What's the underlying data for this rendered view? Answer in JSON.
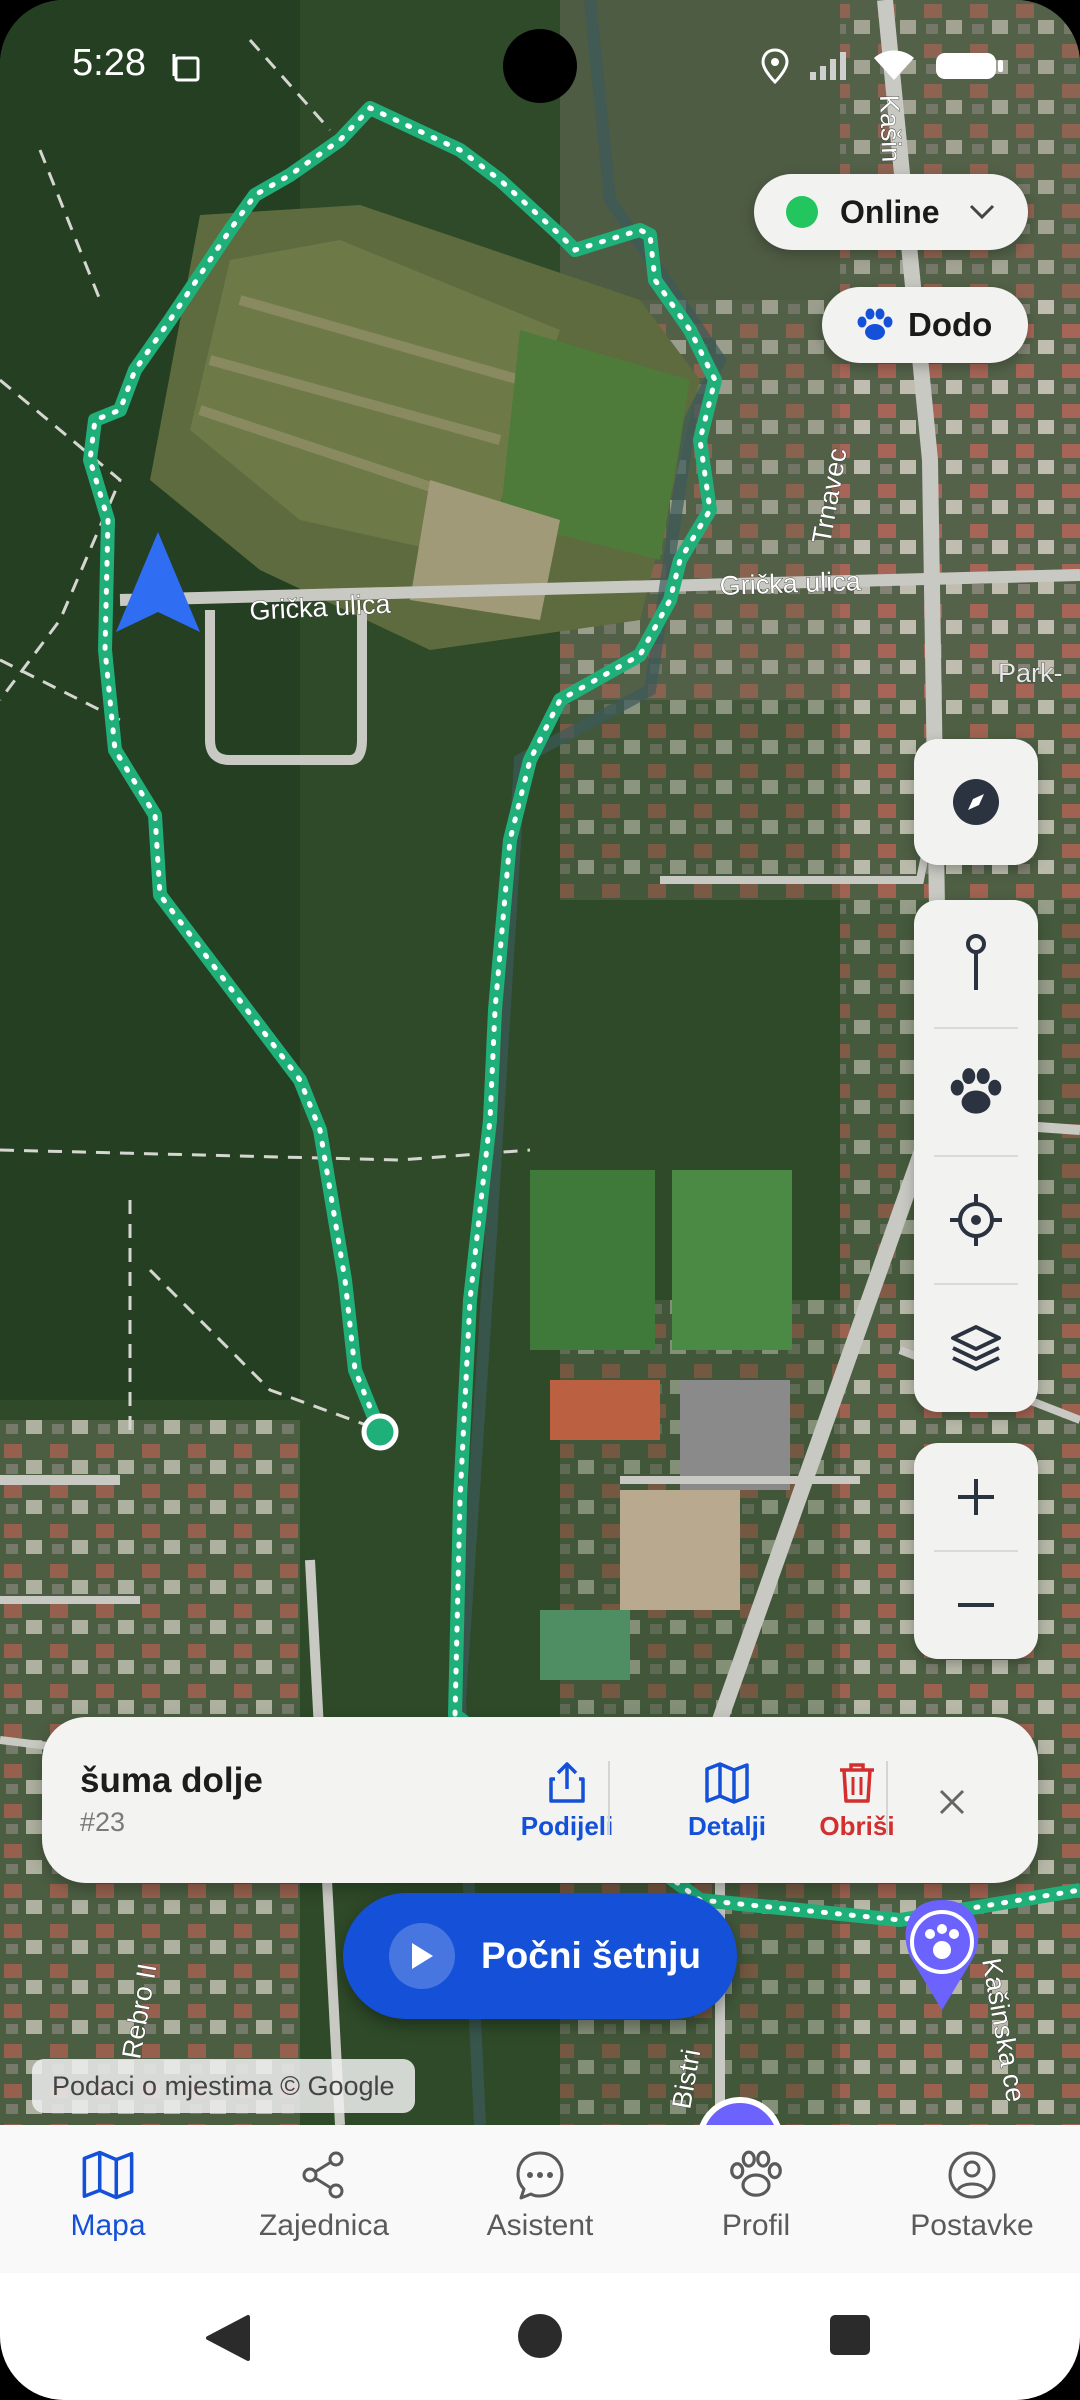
{
  "status_bar": {
    "time": "5:28",
    "icons": [
      "screenshot-icon",
      "location-icon",
      "signal-icon",
      "wifi-icon",
      "battery-icon"
    ]
  },
  "map": {
    "street_labels": [
      "Grička ulica",
      "Grička ulica",
      "Trnavec",
      "Park-",
      "Kašin",
      "Rebro II",
      "Bistri",
      "Kašinska ce"
    ],
    "attribution": "Podaci o mjestima © Google"
  },
  "online_status": {
    "label": "Online",
    "color": "#22c55e"
  },
  "pet_selector": {
    "label": "Dodo",
    "icon": "paw-icon"
  },
  "map_controls": {
    "compass": "compass-icon",
    "tools": [
      "pin-icon",
      "paw-icon",
      "locate-icon",
      "layers-icon"
    ],
    "zoom": [
      "zoom-in-icon",
      "zoom-out-icon"
    ]
  },
  "route_card": {
    "name": "šuma dolje",
    "number": "#23",
    "share_label": "Podijeli",
    "details_label": "Detalji",
    "delete_label": "Obriši"
  },
  "start_walk": {
    "label": "Počni šetnju"
  },
  "bottom_nav": {
    "items": [
      {
        "label": "Mapa",
        "icon": "map-icon",
        "active": true
      },
      {
        "label": "Zajednica",
        "icon": "share-icon",
        "active": false
      },
      {
        "label": "Asistent",
        "icon": "chat-icon",
        "active": false
      },
      {
        "label": "Profil",
        "icon": "paw-icon",
        "active": false
      },
      {
        "label": "Postavke",
        "icon": "account-circle-icon",
        "active": false
      }
    ]
  },
  "colors": {
    "accent": "#1450d8",
    "route": "#1fb07a",
    "delete": "#d32f2f"
  }
}
